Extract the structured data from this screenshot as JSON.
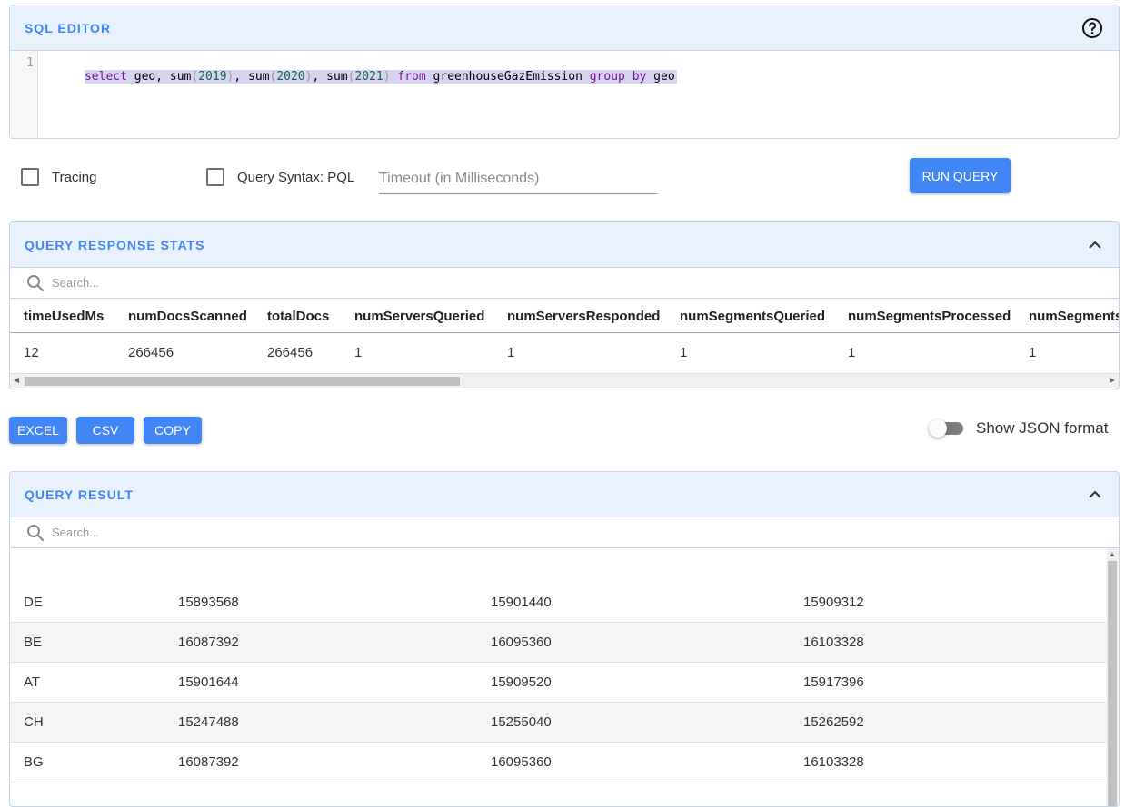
{
  "sql_editor": {
    "title": "SQL EDITOR",
    "line_number": "1",
    "query_tokens": [
      {
        "t": "select",
        "c": "kw"
      },
      {
        "t": " geo, ",
        "c": "fn"
      },
      {
        "t": "sum",
        "c": "fn"
      },
      {
        "t": "(",
        "c": "punc"
      },
      {
        "t": "2019",
        "c": "num"
      },
      {
        "t": ")",
        "c": "punc"
      },
      {
        "t": ", ",
        "c": "fn"
      },
      {
        "t": "sum",
        "c": "fn"
      },
      {
        "t": "(",
        "c": "punc"
      },
      {
        "t": "2020",
        "c": "num"
      },
      {
        "t": ")",
        "c": "punc"
      },
      {
        "t": ", ",
        "c": "fn"
      },
      {
        "t": "sum",
        "c": "fn"
      },
      {
        "t": "(",
        "c": "punc"
      },
      {
        "t": "2021",
        "c": "num"
      },
      {
        "t": ")",
        "c": "punc"
      },
      {
        "t": " from",
        "c": "kw"
      },
      {
        "t": " greenhouseGazEmission ",
        "c": "fn"
      },
      {
        "t": "group by",
        "c": "kw"
      },
      {
        "t": " geo",
        "c": "fn"
      }
    ]
  },
  "options": {
    "tracing_label": "Tracing",
    "tracing_checked": false,
    "pql_label": "Query Syntax: PQL",
    "pql_checked": false,
    "timeout_placeholder": "Timeout (in Milliseconds)",
    "timeout_value": "",
    "run_button": "RUN QUERY"
  },
  "stats": {
    "title": "QUERY RESPONSE STATS",
    "search_placeholder": "Search...",
    "columns": [
      "timeUsedMs",
      "numDocsScanned",
      "totalDocs",
      "numServersQueried",
      "numServersResponded",
      "numSegmentsQueried",
      "numSegmentsProcessed",
      "numSegments"
    ],
    "values": [
      "12",
      "266456",
      "266456",
      "1",
      "1",
      "1",
      "1",
      "1"
    ]
  },
  "export": {
    "excel": "EXCEL",
    "csv": "CSV",
    "copy": "COPY",
    "json_toggle_label": "Show JSON format",
    "json_toggle_on": false
  },
  "result": {
    "title": "QUERY RESULT",
    "search_placeholder": "Search...",
    "rows": [
      [
        "DE",
        "15893568",
        "15901440",
        "15909312"
      ],
      [
        "BE",
        "16087392",
        "16095360",
        "16103328"
      ],
      [
        "AT",
        "15901644",
        "15909520",
        "15917396"
      ],
      [
        "CH",
        "15247488",
        "15255040",
        "15262592"
      ],
      [
        "BG",
        "16087392",
        "16095360",
        "16103328"
      ]
    ]
  },
  "colors": {
    "accent": "#4285f4",
    "header_bg": "#e8f1fc",
    "border": "#c5d4e6"
  }
}
